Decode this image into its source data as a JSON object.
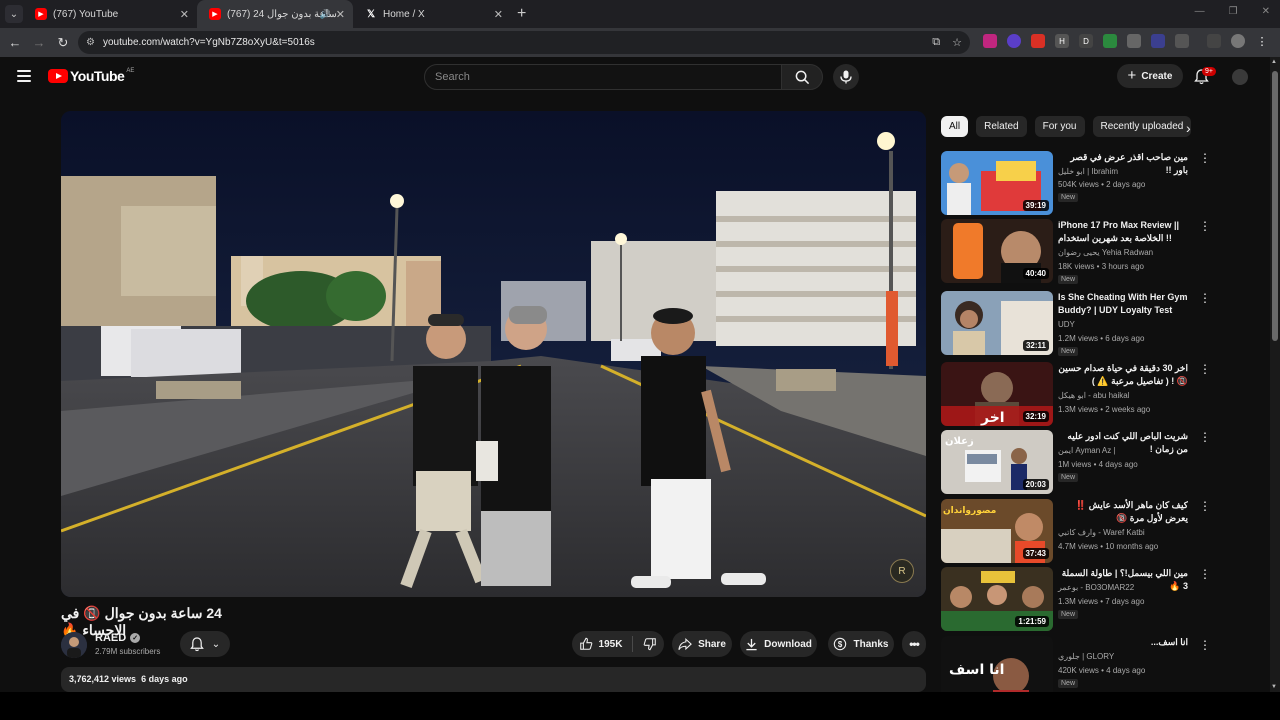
{
  "browser": {
    "tabs": [
      {
        "title": "(767) YouTube",
        "active": false
      },
      {
        "title": "(767) 24 ساعة بدون جوال",
        "active": true
      },
      {
        "title": "Home / X",
        "active": false
      }
    ],
    "url": "youtube.com/watch?v=YgNb7Z8oXyU&t=5016s",
    "new_tab": "+",
    "extensions": [
      "H",
      "D"
    ]
  },
  "header": {
    "logo_text": "YouTube",
    "country": "AE",
    "search_placeholder": "Search",
    "create_label": "Create",
    "notifications_badge": "9+"
  },
  "video": {
    "title": "24 ساعة بدون جوال 📵 في الاحساء 🔥",
    "channel": "RAED",
    "subscribers": "2.79M subscribers",
    "likes": "195K",
    "share_label": "Share",
    "download_label": "Download",
    "thanks_label": "Thanks",
    "views": "3,762,412 views",
    "age": "6 days ago",
    "watermark": "R"
  },
  "chips": [
    "All",
    "Related",
    "For you",
    "Recently uploaded"
  ],
  "recommendations": [
    {
      "title": "مين صاحب اقذر عرض في قصر باور !!",
      "channel": "ابو خليل | Ibrahim",
      "meta": "504K views • 2 days ago",
      "badge": "New",
      "duration": "39:19"
    },
    {
      "title": "iPhone 17 Pro Max Review || الخلاصة بعد شهرين استخدام !!",
      "channel": "يحيى رضوان Yehia Radwan",
      "meta": "18K views • 3 hours ago",
      "badge": "New",
      "duration": "40:40"
    },
    {
      "title": "Is She Cheating With Her Gym Buddy? | UDY Loyalty Test",
      "channel": "UDY",
      "meta": "1.2M views • 6 days ago",
      "badge": "New",
      "duration": "32:11"
    },
    {
      "title": "اخر 30 دقيقة في حياة صدام حسين 📵 ! ( تفاصيل مرعبة ⚠️ )",
      "channel": "ابو هيكل - abu haikal",
      "meta": "1.3M views • 2 weeks ago",
      "badge": "",
      "duration": "32:19"
    },
    {
      "title": "شريت الباص اللي كنت ادور عليه من زمان !",
      "channel": "ايمن Ayman Az |",
      "meta": "1M views • 4 days ago",
      "badge": "New",
      "duration": "20:03"
    },
    {
      "title": "كيف كان ماهر الأسد عايش ‼️ يعرض لأول مرة 🔞",
      "channel": "وارف كاتبي - Waref Katbi",
      "meta": "4.7M views • 10 months ago",
      "badge": "",
      "duration": "37:43"
    },
    {
      "title": "مين اللي بيسمل!؟ | طاولة السملة 3 🔥",
      "channel": "بوعمر - BO3OMAR22",
      "meta": "1.3M views • 7 days ago",
      "badge": "New",
      "duration": "1:21:59"
    },
    {
      "title": "انا اسف...",
      "channel": "جلوري | GLORY",
      "meta": "420K views • 4 days ago",
      "badge": "New",
      "duration": ""
    }
  ],
  "thumb_text": {
    "t4": "اخر",
    "t5": "زعلان",
    "t6": "مصورواندان",
    "t8": "انا اسف"
  }
}
